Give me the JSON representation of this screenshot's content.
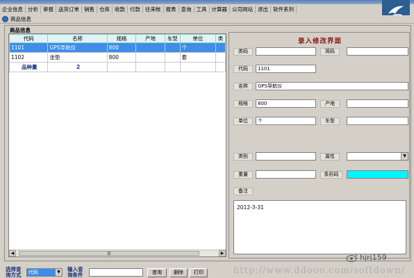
{
  "menubar": {
    "items": [
      "企业信息",
      "分析",
      "审报",
      "送货订单",
      "销售",
      "仓库",
      "收款",
      "付款",
      "往来帐",
      "报表",
      "查询",
      "工具",
      "计算器",
      "公司网站",
      "退出",
      "软件系列"
    ]
  },
  "window": {
    "title": "商品信息"
  },
  "group": {
    "label": "商品信息"
  },
  "grid": {
    "columns": [
      "代码",
      "名称",
      "规格",
      "产地",
      "车型",
      "单位",
      "类"
    ],
    "rows": [
      {
        "code": "1101",
        "name": "GPS导航仪",
        "spec": "800",
        "origin": "",
        "model": "",
        "unit": "个",
        "type": "",
        "selected": true
      },
      {
        "code": "1102",
        "name": "坐垫",
        "spec": "800",
        "origin": "",
        "model": "",
        "unit": "套",
        "type": "",
        "selected": false
      }
    ],
    "summary_label": "品种量",
    "summary_value": "2"
  },
  "form": {
    "title": "录入修改界面",
    "labels": {
      "category_code": "类码",
      "short_code": "简码",
      "code": "代码",
      "name": "名称",
      "spec": "规格",
      "origin": "产地",
      "unit": "单位",
      "model": "车型",
      "category": "类别",
      "attribute": "属性",
      "weight": "重量",
      "barcode": "条形码",
      "remark": "备注"
    },
    "values": {
      "category_code": "",
      "short_code": "",
      "code": "1101",
      "name": "GPS导航仪",
      "spec": "800",
      "origin": "",
      "unit": "个",
      "model": "",
      "category": "",
      "attribute": "",
      "weight": "",
      "barcode": "",
      "remark": "2012-3-31"
    }
  },
  "bottom": {
    "select_label": "选择查询方式",
    "select_value": "代码",
    "input_label": "输入查询条件",
    "query_value": "",
    "buttons": {
      "query": "查询",
      "delete": "删除",
      "print": "打印"
    }
  },
  "watermark": "http://www.ddooo.com/softdown/",
  "weibo": "hjrj159",
  "colors": {
    "selection": "#3d8ee8",
    "barcode_field": "#00f6ff",
    "form_title": "#8b1a1a",
    "header": "#dff4f4"
  }
}
